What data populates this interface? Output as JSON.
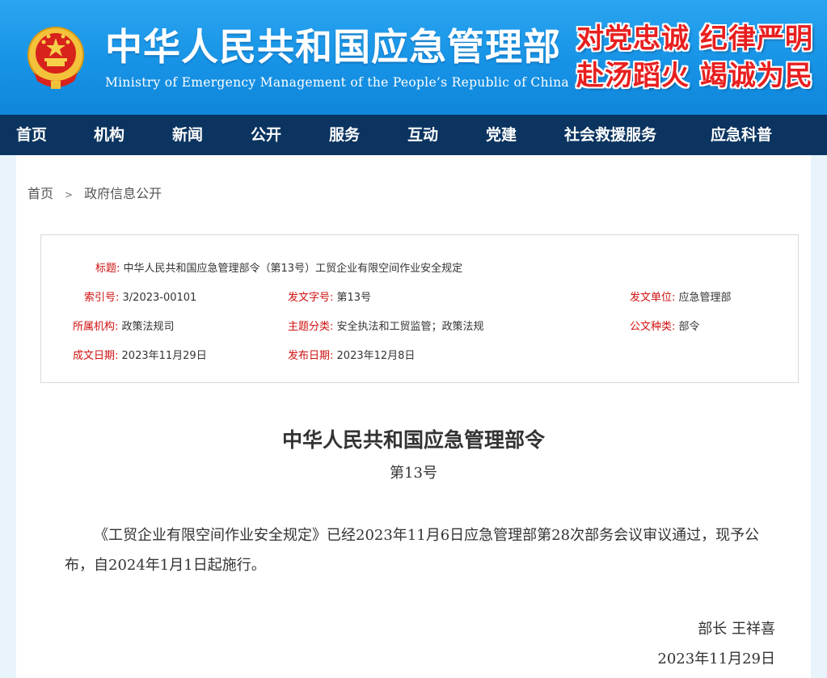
{
  "header": {
    "title": "中华人民共和国应急管理部",
    "subtitle": "Ministry of Emergency Management of the People’s Republic of China",
    "slogan_line1": "对党忠诚  纪律严明",
    "slogan_line2": "赴汤蹈火  竭诚为民",
    "colors": {
      "header_blue": "#1793e6",
      "nav_navy": "#0b3460",
      "label_red": "#d01010",
      "slogan_red": "#e81f1f"
    }
  },
  "nav": {
    "items": [
      "首页",
      "机构",
      "新闻",
      "公开",
      "服务",
      "互动",
      "党建",
      "社会救援服务",
      "应急科普"
    ]
  },
  "breadcrumb": {
    "home": "首页",
    "separator": ">",
    "current": "政府信息公开"
  },
  "info": {
    "title_label": "标题:",
    "title_value": "中华人民共和国应急管理部令（第13号）工贸企业有限空间作业安全规定",
    "index_label": "索引号:",
    "index_value": "3/2023-00101",
    "doc_no_label": "发文字号:",
    "doc_no_value": "第13号",
    "issuer_label": "发文单位:",
    "issuer_value": "应急管理部",
    "org_label": "所属机构:",
    "org_value": "政策法规司",
    "topic_label": "主题分类:",
    "topic_value": "安全执法和工贸监管；政策法规",
    "type_label": "公文种类:",
    "type_value": "部令",
    "created_label": "成文日期:",
    "created_value": "2023年11月29日",
    "published_label": "发布日期:",
    "published_value": "2023年12月8日"
  },
  "document": {
    "title": "中华人民共和国应急管理部令",
    "number": "第13号",
    "body": "《工贸企业有限空间作业安全规定》已经2023年11月6日应急管理部第28次部务会议审议通过，现予公布，自2024年1月1日起施行。",
    "sign_role": "部长  王祥喜",
    "sign_date": "2023年11月29日"
  }
}
